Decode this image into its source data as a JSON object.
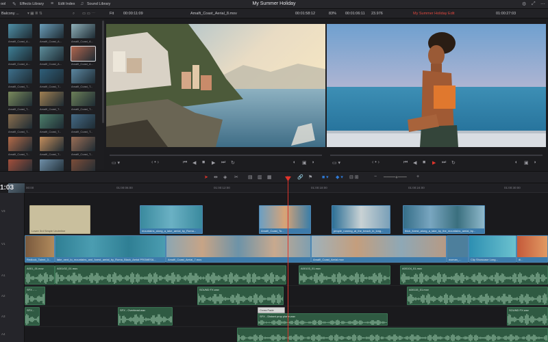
{
  "topbar": {
    "items": [
      {
        "label": "ool"
      },
      {
        "label": "Effects Library"
      },
      {
        "label": "Edit Index"
      },
      {
        "label": "Sound Library"
      }
    ],
    "title": "My Summer Holiday"
  },
  "subbar": {
    "bin": "Balcony ...",
    "zoom_left": "Fit",
    "tc_left": "00:00:11:09",
    "clip_name": "Amalfi_Coast_Aerial_8.mov",
    "duration": "00:01:58:12",
    "zoom_right": "83%",
    "tc_mid": "00:01:06:11",
    "fps": "23.976",
    "timeline_name": "My Summer Holiday Edit",
    "tc_right": "01:00:27:03"
  },
  "pool": {
    "thumbs": [
      {
        "label": "Amalfi_Coast_A...",
        "color": "#4f8fa6"
      },
      {
        "label": "Amalfi_Coast_A...",
        "color": "#6a9db8"
      },
      {
        "label": "Amalfi_Coast_A...",
        "color": "#8fb0b9"
      },
      {
        "label": "Amalfi_Coast_A...",
        "color": "#3e7f96"
      },
      {
        "label": "Amalfi_Coast_A...",
        "color": "#5d8e9c"
      },
      {
        "label": "Amalfi_Coast_A...",
        "color": "#b0654e"
      },
      {
        "label": "Amalfi_Coast_T...",
        "color": "#3d6f8b"
      },
      {
        "label": "Amalfi_Coast_T...",
        "color": "#2f5f7a"
      },
      {
        "label": "Amalfi_Coast_T...",
        "color": "#5b86a0"
      },
      {
        "label": "Amalfi_Coast_T...",
        "color": "#7a8a5c"
      },
      {
        "label": "Amalfi_Coast_T...",
        "color": "#a07f52"
      },
      {
        "label": "Amalfi_Coast_T...",
        "color": "#6c7f58"
      },
      {
        "label": "Amalfi_Coast_T...",
        "color": "#8a6e4e"
      },
      {
        "label": "Amalfi_Coast_T...",
        "color": "#4d7e6b"
      },
      {
        "label": "Amalfi_Coast_T...",
        "color": "#456a85"
      },
      {
        "label": "Amalfi_Coast_T...",
        "color": "#b46a48"
      },
      {
        "label": "Amalfi_Coast_T...",
        "color": "#c48e5c"
      },
      {
        "label": "Amalfi_Coast_T...",
        "color": "#9a6d55"
      },
      {
        "label": "Redlfock_Land...",
        "color": "#a34f3b"
      },
      {
        "label": "Redlfock_Land...",
        "color": "#6f8fa8"
      },
      {
        "label": "Redlfock_Land...",
        "color": "#7c4d39"
      },
      {
        "label": "",
        "color": "#5c6c7a"
      },
      {
        "label": "",
        "color": "#a86b4f"
      },
      {
        "label": "",
        "color": "#4c6576"
      }
    ]
  },
  "ruler": {
    "timecode": "1:03",
    "ticks": [
      "00:00",
      "01:00:06:00",
      "01:00:12:00",
      "01:00:18:00",
      "01:00:24:00",
      "01:00:30:00",
      "01:00:36:00",
      "01:00:42:00",
      "01:00:48:00"
    ]
  },
  "tracks": {
    "headers": [
      "V3",
      "V2",
      "V1",
      "A1",
      "A2",
      "A3",
      "A4"
    ],
    "v3_clips": [
      {
        "label": "Lower 3rd Simple Underline"
      },
      {
        "label": "mountains_along_a_lake_aerial_by_Roma..."
      },
      {
        "label": "Amalfi_Coast_To..."
      },
      {
        "label": "people_running_at_the_beach_in_long..."
      },
      {
        "label": "thick_forest_along_a_lake_by_the_mountains_aerial_by..."
      }
    ],
    "v1_clips": [
      {
        "label": "Redlock_Talent_3..."
      },
      {
        "label": "lake_next_to_mountains_and_forest_aerial_by_Roma_Black_Aerial PROMESA..."
      },
      {
        "label": "Amalfi_Coast_Aerial_7.mov"
      },
      {
        "label": "Amalfi_Coast_Aerial.mov"
      },
      {
        "label": "woman_..."
      },
      {
        "label": "Clip Showcase Long..."
      },
      {
        "label": "di..."
      }
    ],
    "a1_clips": [
      {
        "label": "A001_01.mov"
      },
      {
        "label": "A001/02_01.mov"
      },
      {
        "label": "A00103_01.mov"
      },
      {
        "label": "A00104_01.mov"
      }
    ],
    "a2_clips": [
      {
        "label": "SFX - ..."
      },
      {
        "label": "SOUND FX.wav"
      },
      {
        "label": "A00115_01.mov"
      }
    ],
    "a3_clips": [
      {
        "label": "SFX..."
      },
      {
        "label": "SFX - Overhead.wav"
      },
      {
        "label": "Cross Fade"
      },
      {
        "label": "SFX - Distant prop plane.wav"
      },
      {
        "label": "SOUND FX.wav"
      }
    ]
  },
  "colors": {
    "accent_red": "#e0342b",
    "video_clip": "#2c5d85",
    "audio_clip": "#2f5a42"
  }
}
